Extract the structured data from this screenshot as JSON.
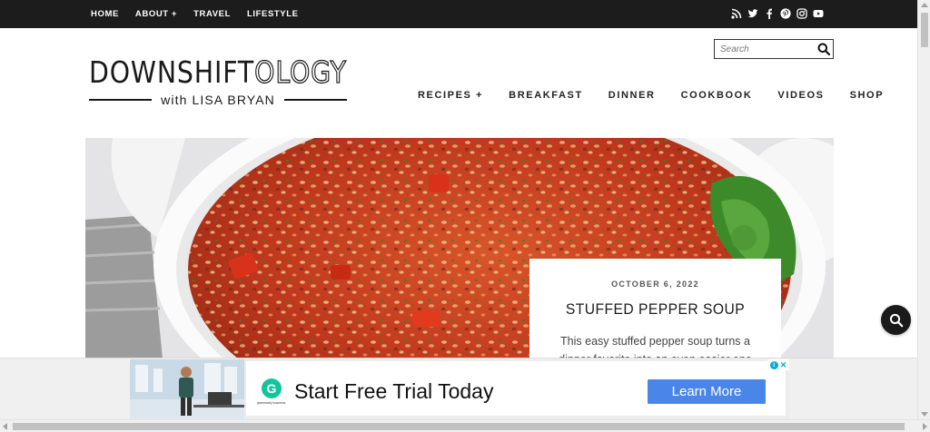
{
  "topbar": {
    "nav": [
      "HOME",
      "ABOUT +",
      "TRAVEL",
      "LIFESTYLE"
    ],
    "social_icons": [
      "rss-icon",
      "twitter-icon",
      "facebook-icon",
      "pinterest-icon",
      "instagram-icon",
      "youtube-icon"
    ]
  },
  "search": {
    "placeholder": "Search"
  },
  "logo": {
    "title_solid": "DOWNSHIFT",
    "title_outline": "OLOGY",
    "subtitle": "with LISA BRYAN"
  },
  "mainnav": [
    "RECIPES +",
    "BREAKFAST",
    "DINNER",
    "COOKBOOK",
    "VIDEOS",
    "SHOP"
  ],
  "featured": {
    "date": "OCTOBER 6, 2022",
    "title": "STUFFED PEPPER SOUP",
    "excerpt": "This easy stuffed pepper soup turns a dinner favorite into an even easier one"
  },
  "ad": {
    "brand_initial": "G",
    "brand_name": "grammarly business",
    "headline": "Start Free Trial Today",
    "cta": "Learn More"
  },
  "colors": {
    "topbar": "#1c1c1c",
    "cta": "#4a86e8",
    "brand": "#15c39a",
    "soup": "#c0391e"
  }
}
